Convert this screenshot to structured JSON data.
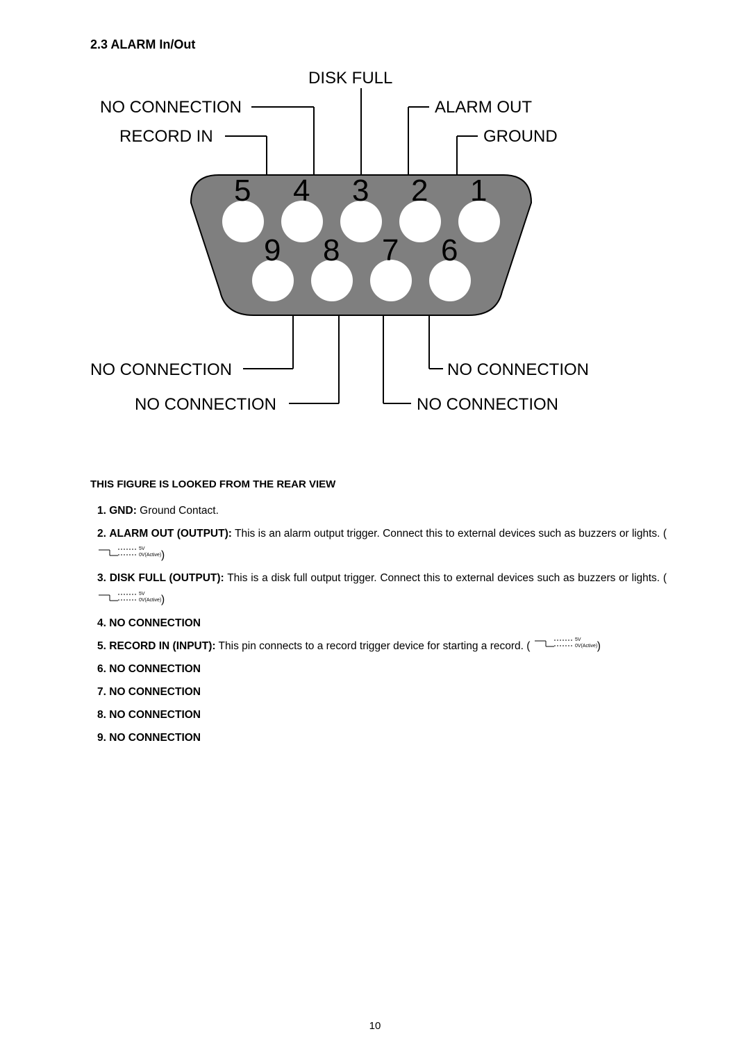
{
  "section_title": "2.3 ALARM In/Out",
  "figure": {
    "pin_numbers": [
      "5",
      "4",
      "3",
      "2",
      "1",
      "9",
      "8",
      "7",
      "6"
    ],
    "labels": {
      "disk_full": "DISK FULL",
      "no_connection_4": "NO CONNECTION",
      "record_in": "RECORD IN",
      "alarm_out": "ALARM OUT",
      "ground": "GROUND",
      "no_connection_9": "NO CONNECTION",
      "no_connection_8": "NO CONNECTION",
      "no_connection_7": "NO CONNECTION",
      "no_connection_6": "NO CONNECTION"
    }
  },
  "caption": "THIS FIGURE IS LOOKED FROM THE REAR VIEW",
  "pins": [
    {
      "num": "1.",
      "name": "GND:",
      "desc": " Ground Contact."
    },
    {
      "num": "2.",
      "name": "ALARM OUT (OUTPUT):",
      "desc": " This is an alarm output trigger. Connect this to external devices such as buzzers or lights. (",
      "signal": true,
      "tail": ")"
    },
    {
      "num": "3.",
      "name": "DISK FULL (OUTPUT):",
      "desc": " This is a disk full output trigger. Connect this to external devices such as buzzers or lights. (",
      "signal": true,
      "tail": ")"
    },
    {
      "num": "4.",
      "name": "NO CONNECTION",
      "desc": ""
    },
    {
      "num": "5.",
      "name": "RECORD IN (INPUT):",
      "desc": " This pin connects to a record trigger device for starting a record. (",
      "signal": true,
      "tail": ")"
    },
    {
      "num": "6.",
      "name": "NO CONNECTION",
      "desc": ""
    },
    {
      "num": "7.",
      "name": "NO CONNECTION",
      "desc": ""
    },
    {
      "num": "8.",
      "name": "NO CONNECTION",
      "desc": ""
    },
    {
      "num": "9.",
      "name": "NO CONNECTION",
      "desc": ""
    }
  ],
  "signal": {
    "high": "5V",
    "low": "0V(Active)"
  },
  "page_number": "10"
}
